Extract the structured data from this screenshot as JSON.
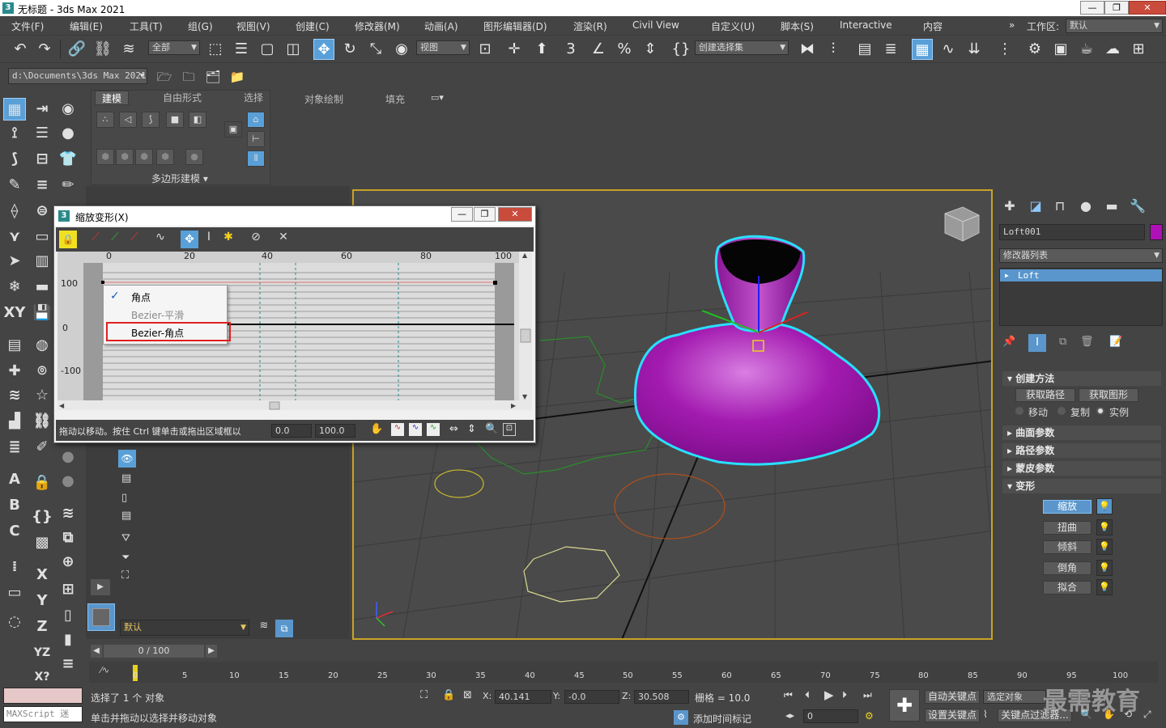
{
  "window": {
    "title": "无标题 - 3ds Max 2021"
  },
  "menu": [
    "文件(F)",
    "编辑(E)",
    "工具(T)",
    "组(G)",
    "视图(V)",
    "创建(C)",
    "修改器(M)",
    "动画(A)",
    "图形编辑器(D)",
    "渲染(R)",
    "Civil View",
    "自定义(U)",
    "脚本(S)",
    "Interactive",
    "内容"
  ],
  "workspace": {
    "label": "工作区:",
    "value": "默认"
  },
  "toolbar": {
    "filter": "全部",
    "ref_coord": "视图",
    "selection_set": "创建选择集"
  },
  "project_path": "d:\\Documents\\3ds Max 2021",
  "ribbon": {
    "tabs": [
      "建模",
      "自由形式",
      "选择",
      "对象绘制",
      "填充"
    ],
    "panel_label": "多边形建模"
  },
  "dialog": {
    "title": "缩放变形(X)",
    "ruler_ticks": [
      "0",
      "20",
      "40",
      "60",
      "80",
      "100"
    ],
    "y_labels": [
      "100",
      "0",
      "-100"
    ],
    "context_menu": [
      {
        "label": "角点",
        "checked": true,
        "disabled": false
      },
      {
        "label": "Bezier-平滑",
        "checked": false,
        "disabled": true
      },
      {
        "label": "Bezier-角点",
        "checked": false,
        "disabled": false
      }
    ],
    "status_text": "拖动以移动。按住 Ctrl 键单击或拖出区域框以",
    "field_1": "0.0",
    "field_2": "100.0"
  },
  "explorer": {
    "layer_label": "默认"
  },
  "command_panel": {
    "object_name": "Loft001",
    "object_color": "#b010b8",
    "modifier_list": "修改器列表",
    "stack_item": "Loft",
    "creation_method": {
      "title": "创建方法",
      "get_path": "获取路径",
      "get_shape": "获取图形",
      "options": [
        "移动",
        "复制",
        "实例"
      ]
    },
    "rollouts": [
      "曲面参数",
      "路径参数",
      "蒙皮参数"
    ],
    "deformations": {
      "title": "变形",
      "buttons": [
        "缩放",
        "扭曲",
        "倾斜",
        "倒角",
        "拟合"
      ]
    }
  },
  "timeline": {
    "frame_display": "0 / 100",
    "ticks": [
      "0",
      "5",
      "10",
      "15",
      "20",
      "25",
      "30",
      "35",
      "40",
      "45",
      "50",
      "55",
      "60",
      "65",
      "70",
      "75",
      "80",
      "85",
      "90",
      "95",
      "100"
    ]
  },
  "status": {
    "selection": "选择了 1 个 对象",
    "prompt": "单击并拖动以选择并移动对象",
    "maxscript": "MAXScript 迷",
    "x_label": "X:",
    "x": "40.141",
    "y_label": "Y:",
    "y": "-0.0",
    "z_label": "Z:",
    "z": "30.508",
    "grid": "栅格 = 10.0",
    "add_time_tag": "添加时间标记",
    "auto_key": "自动关键点",
    "selected_obj": "选定对象",
    "set_key": "设置关键点",
    "key_filters": "关键点过滤器...",
    "frame_field": "0"
  },
  "watermark": "最需教育"
}
